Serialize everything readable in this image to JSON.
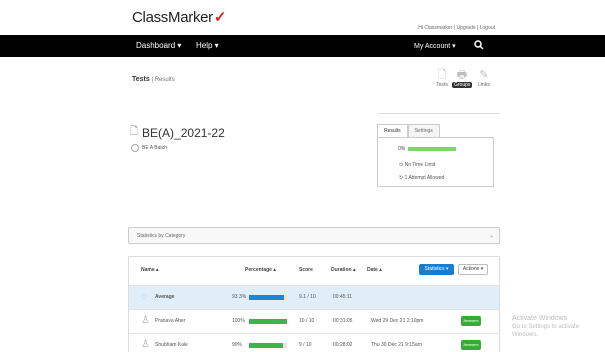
{
  "brand": {
    "name": "ClassMarker",
    "mark": "✓"
  },
  "top_links": "Hi Classmarker | Upgrade | Logout",
  "nav": {
    "dashboard": "Dashboard ▾",
    "help": "Help ▾",
    "account": "My Account ▾",
    "search_icon": "search-icon"
  },
  "breadcrumb": {
    "tests": "Tests",
    "separator": "|",
    "current": "Results"
  },
  "toolbar": [
    {
      "label": "Tests",
      "icon": "document-icon",
      "glyph": "🗋"
    },
    {
      "label": "Groups",
      "icon": "printer-icon",
      "glyph": "🖶"
    },
    {
      "label": "Links",
      "icon": "link-icon",
      "glyph": "✎"
    }
  ],
  "test": {
    "title": "BE(A)_2021-22",
    "group": "BE A Batch"
  },
  "tabs": [
    "Results",
    "Settings"
  ],
  "settings_panel": {
    "percent": "0%",
    "option1": "No Time Limit",
    "option2": "1 Attempt Allowed"
  },
  "stats_section": {
    "label": "Statistics by Category"
  },
  "table": {
    "headers": {
      "name": "Name ▴",
      "percentage": "Percentage ▴",
      "score": "Score",
      "duration": "Duration ▴",
      "date": "Date ▴"
    },
    "statistics_button": "Statistics ▾",
    "actions_button": "Actions ▾",
    "rows": [
      {
        "name": "Average",
        "percentage": "93.3%",
        "percent_value": 93.3,
        "score": "9.1 / 10",
        "duration": "00:45:11",
        "date": "",
        "action": "",
        "bar_color": "#1a86d8"
      },
      {
        "name": "Pranava Aher",
        "percentage": "100%",
        "percent_value": 100,
        "score": "10 / 10",
        "duration": "00:31:05",
        "date": "Wed 29 Dec 21 2:10pm",
        "action": "Answers",
        "bar_color": "#3fb34f"
      },
      {
        "name": "Shubham Kale",
        "percentage": "90%",
        "percent_value": 90,
        "score": "9 / 10",
        "duration": "00:28:02",
        "date": "Thu 30 Dec 21 9:15am",
        "action": "Answers",
        "bar_color": "#3fb34f"
      }
    ]
  },
  "watermark": {
    "line1": "Activate Windows",
    "line2": "Go to Settings to activate Windows."
  }
}
